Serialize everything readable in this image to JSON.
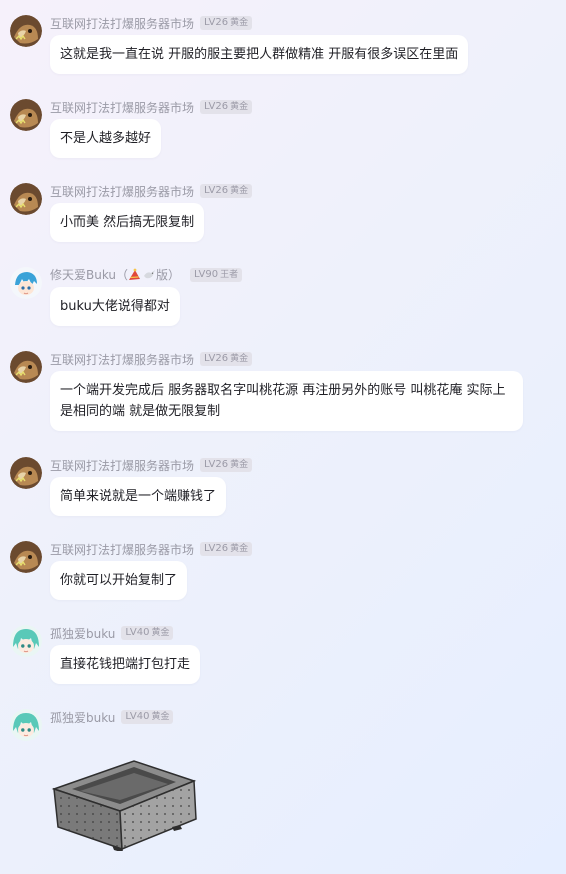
{
  "messages": [
    {
      "sender": "互联网打法打爆服务器市场",
      "level": "LV26",
      "title": "黄金",
      "text": "这就是我一直在说 开服的服主要把人群做精准 开服有很多误区在里面",
      "avatar": "dog-avatar"
    },
    {
      "sender": "互联网打法打爆服务器市场",
      "level": "LV26",
      "title": "黄金",
      "text": "不是人越多越好",
      "avatar": "dog-avatar"
    },
    {
      "sender": "互联网打法打爆服务器市场",
      "level": "LV26",
      "title": "黄金",
      "text": "小而美 然后搞无限复制",
      "avatar": "dog-avatar"
    },
    {
      "sender": "修天爱Buku（",
      "sender_suffix": "版）",
      "level": "LV90",
      "title": "王者",
      "text": "buku大佬说得都对",
      "avatar": "anime-blue-hair-avatar"
    },
    {
      "sender": "互联网打法打爆服务器市场",
      "level": "LV26",
      "title": "黄金",
      "text": "一个端开发完成后 服务器取名字叫桃花源 再注册另外的账号 叫桃花庵 实际上是相同的端 就是做无限复制",
      "avatar": "dog-avatar"
    },
    {
      "sender": "互联网打法打爆服务器市场",
      "level": "LV26",
      "title": "黄金",
      "text": "简单来说就是一个端赚钱了",
      "avatar": "dog-avatar"
    },
    {
      "sender": "互联网打法打爆服务器市场",
      "level": "LV26",
      "title": "黄金",
      "text": "你就可以开始复制了",
      "avatar": "dog-avatar"
    },
    {
      "sender": "孤独爱buku",
      "level": "LV40",
      "title": "黄金",
      "text": "直接花钱把端打包打走",
      "avatar": "anime-teal-hair-avatar"
    },
    {
      "sender": "孤独爱buku",
      "level": "LV40",
      "title": "黄金",
      "image": "hopper-block-sticker",
      "avatar": "anime-teal-hair-avatar"
    }
  ],
  "colors": {
    "name": "#9a9aa6",
    "badge_bg": "#e3e2ea",
    "bubble_bg": "#ffffff",
    "text": "#1f1f25"
  }
}
